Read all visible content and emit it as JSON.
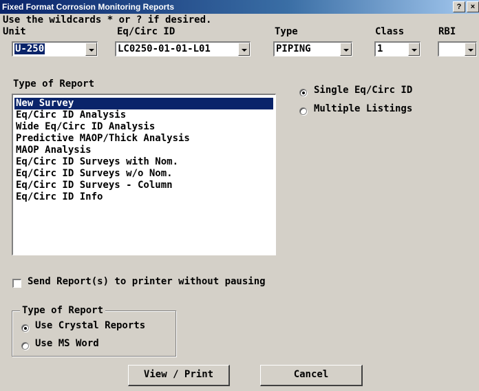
{
  "window": {
    "title": "Fixed Format Corrosion Monitoring Reports",
    "help_button": "?",
    "close_button": "×"
  },
  "instructions": "Use the wildcards * or ? if desired.",
  "filters": {
    "unit": {
      "label": "Unit",
      "value": "U-250"
    },
    "eqcirc": {
      "label": "Eq/Circ ID",
      "value": "LC0250-01-01-L01"
    },
    "type": {
      "label": "Type",
      "value": "PIPING"
    },
    "class": {
      "label": "Class",
      "value": "1"
    },
    "rbi": {
      "label": "RBI",
      "value": ""
    }
  },
  "report_list": {
    "label": "Type of Report",
    "selected_index": 0,
    "items": [
      "New Survey",
      "Eq/Circ ID Analysis",
      "Wide Eq/Circ ID Analysis",
      "Predictive MAOP/Thick Analysis",
      "MAOP Analysis",
      "Eq/Circ ID Surveys with Nom.",
      "Eq/Circ ID Surveys w/o Nom.",
      "Eq/Circ ID Surveys - Column",
      "Eq/Circ ID Info"
    ]
  },
  "scope": {
    "options": [
      "Single Eq/Circ ID",
      "Multiple Listings"
    ],
    "selected": "Single Eq/Circ ID"
  },
  "send_to_printer": {
    "label": "Send Report(s) to printer without pausing",
    "checked": false
  },
  "engine": {
    "label": "Type of Report",
    "options": [
      "Use Crystal Reports",
      "Use MS Word"
    ],
    "selected": "Use Crystal Reports"
  },
  "buttons": {
    "view_print": "View / Print",
    "cancel": "Cancel"
  },
  "colors": {
    "face": "#d4d0c8",
    "selection": "#0a246a",
    "title_start": "#0a246a",
    "title_end": "#a6caf0"
  }
}
